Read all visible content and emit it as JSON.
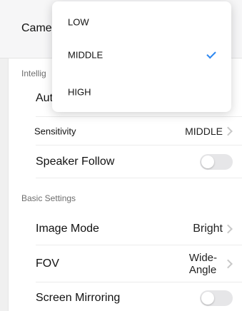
{
  "header": {
    "title": "Came",
    "trailing": ""
  },
  "sections": {
    "intelligent_label": "Intellig",
    "basic_label": "Basic Settings"
  },
  "rows": {
    "auto_label": "Aut",
    "sensitivity_label": "Sensitivity",
    "sensitivity_value": "MIDDLE",
    "speaker_follow_label": "Speaker Follow",
    "image_mode_label": "Image Mode",
    "image_mode_value": "Bright",
    "fov_label": "FOV",
    "fov_value_line1": "Wide-",
    "fov_value_line2": "Angle",
    "screen_mirroring_label": "Screen Mirroring"
  },
  "toggles": {
    "speaker_follow_on": false,
    "screen_mirroring_on": false
  },
  "dropdown": {
    "options": [
      "LOW",
      "MIDDLE",
      "HIGH"
    ],
    "selected": "MIDDLE",
    "accent_color": "#2d87f0"
  },
  "icons": {
    "chevron": "chevron-right-icon",
    "check": "check-icon"
  }
}
